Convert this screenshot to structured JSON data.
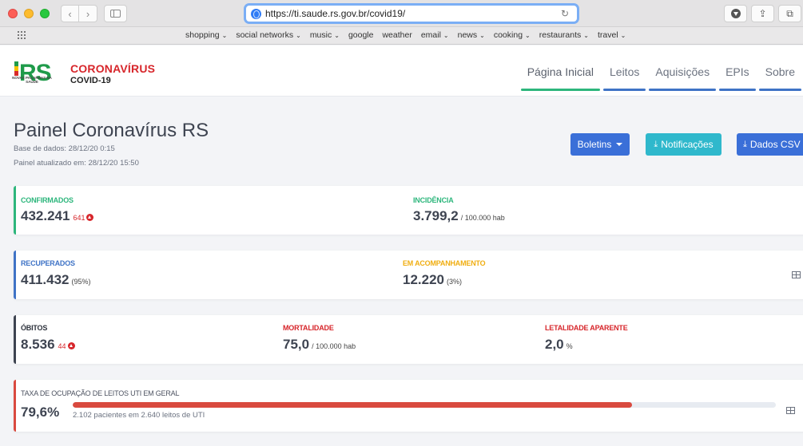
{
  "browser": {
    "url": "https://ti.saude.rs.gov.br/covid19/",
    "favorites": [
      "shopping",
      "social networks",
      "music",
      "google",
      "weather",
      "email",
      "news",
      "cooking",
      "restaurants",
      "travel"
    ],
    "favorites_with_menu": [
      true,
      true,
      true,
      false,
      false,
      true,
      true,
      true,
      true,
      true
    ]
  },
  "header": {
    "logo_text": "RS",
    "logo_tagline": "NOVAS PAÇARNAS NA SAÚDE",
    "brand_title": "CORONAVÍRUS",
    "brand_subtitle": "COVID-19",
    "nav": [
      "Página Inicial",
      "Leitos",
      "Aquisições",
      "EPIs",
      "Sobre"
    ],
    "active_nav": "Página Inicial"
  },
  "panel": {
    "title": "Painel Coronavírus RS",
    "database": "Base de dados: 28/12/20 0:15",
    "updated": "Painel atualizado em: 28/12/20 15:50",
    "buttons": {
      "boletins": "Boletins",
      "notificacoes": "Notificações",
      "dados_csv": "Dados CSV"
    }
  },
  "stats": {
    "confirmados": {
      "label": "CONFIRMADOS",
      "value": "432.241",
      "delta": "641"
    },
    "incidencia": {
      "label": "INCIDÊNCIA",
      "value": "3.799,2",
      "unit": "/ 100.000 hab"
    },
    "recuperados": {
      "label": "RECUPERADOS",
      "value": "411.432",
      "pct": "(95%)"
    },
    "acompanhamento": {
      "label": "EM ACOMPANHAMENTO",
      "value": "12.220",
      "pct": "(3%)"
    },
    "obitos": {
      "label": "ÓBITOS",
      "value": "8.536",
      "delta": "44"
    },
    "mortalidade": {
      "label": "MORTALIDADE",
      "value": "75,0",
      "unit": "/ 100.000 hab"
    },
    "letalidade": {
      "label": "LETALIDADE APARENTE",
      "value": "2,0",
      "unit": "%"
    },
    "uti": {
      "label": "TAXA DE OCUPAÇÃO DE LEITOS UTI EM GERAL",
      "value": "79,6%",
      "fraction": 0.796,
      "detail": "2.102 pacientes em 2.640 leitos de UTI"
    }
  },
  "colors": {
    "green": "#2db67c",
    "blue": "#3f73c6",
    "yellow": "#f0ae12",
    "red": "#d7262b",
    "button_blue": "#3a6fd8",
    "button_cyan": "#2fb8cc"
  }
}
